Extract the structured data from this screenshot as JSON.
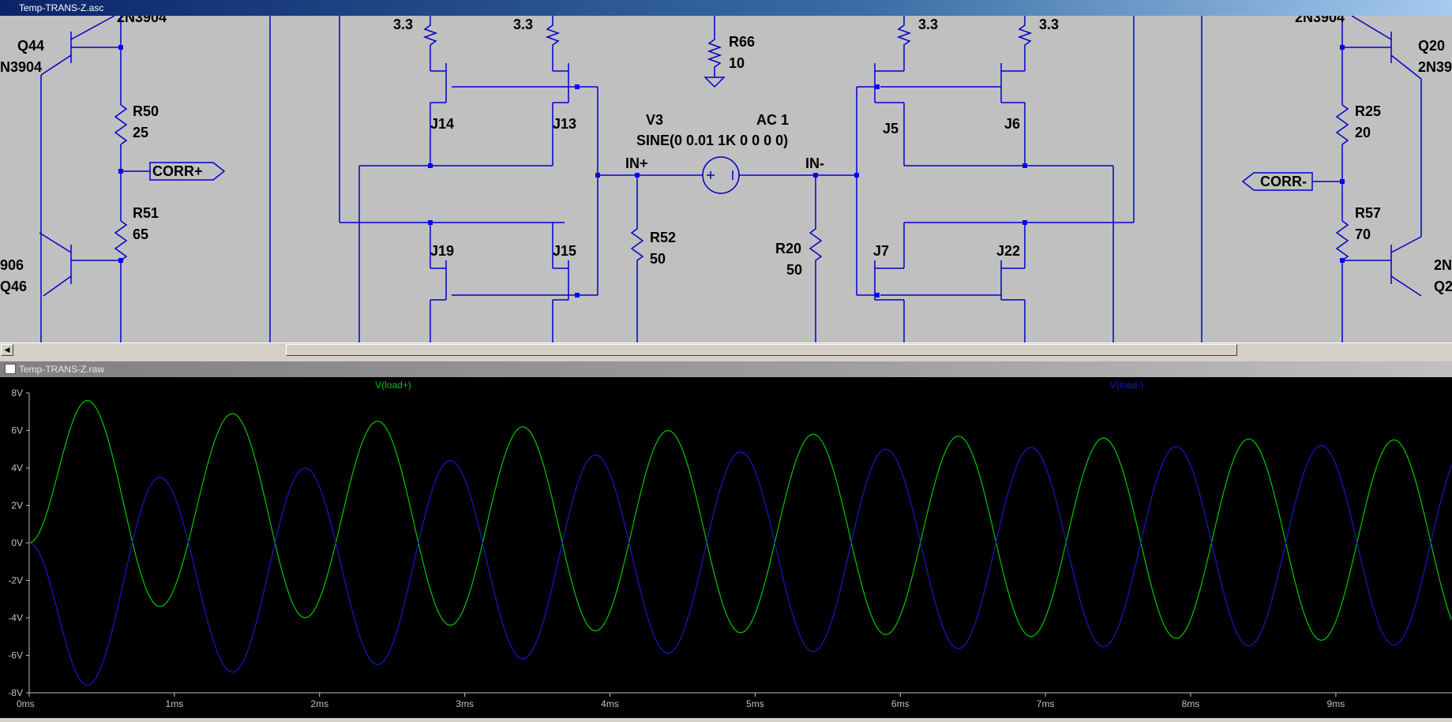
{
  "schematic_window": {
    "title": "Temp-TRANS-Z.asc"
  },
  "waveform_window": {
    "title": "Temp-TRANS-Z.raw"
  },
  "schematic": {
    "labels": {
      "q44_partial_model": "2N3904",
      "q44": "Q44",
      "q44_model": "N3904",
      "r50": "R50",
      "r50_val": "25",
      "corr_plus": "CORR+",
      "r51": "R51",
      "r51_val": "65",
      "q46_model": "906",
      "q46": "Q46",
      "j14_supply": "3.3",
      "j13_supply": "3.3",
      "j14": "J14",
      "j13": "J13",
      "j19": "J19",
      "j15": "J15",
      "r66": "R66",
      "r66_val": "10",
      "v3": "V3",
      "v3_ac": "AC 1",
      "v3_sine": "SINE(0 0.01 1K 0 0 0 0)",
      "in_plus": "IN+",
      "in_minus": "IN-",
      "r52": "R52",
      "r52_val": "50",
      "r20": "R20",
      "r20_val": "50",
      "j5_supply": "3.3",
      "j6_supply": "3.3",
      "j5": "J5",
      "j6": "J6",
      "j7": "J7",
      "j22": "J22",
      "q20_partial_model": "2N3904",
      "q20": "Q20",
      "q20_model": "2N39",
      "r25": "R25",
      "r25_val": "20",
      "corr_minus": "CORR-",
      "r57": "R57",
      "r57_val": "70",
      "q2x_model": "2N",
      "q2x": "Q2"
    }
  },
  "colors": {
    "wire": "#0000cc",
    "junction": "#0000ff",
    "trace_plus": "#00c800",
    "trace_minus": "#1818c8",
    "axis": "#c0c0c0"
  },
  "chart_data": {
    "type": "line",
    "x_label_unit": "ms",
    "xlim": [
      0,
      9.8
    ],
    "ylim": [
      -8,
      8
    ],
    "x_ticks": [
      "0ms",
      "1ms",
      "2ms",
      "3ms",
      "4ms",
      "5ms",
      "6ms",
      "7ms",
      "8ms",
      "9ms"
    ],
    "y_ticks": [
      "8V",
      "6V",
      "4V",
      "2V",
      "0V",
      "-2V",
      "-4V",
      "-6V",
      "-8V"
    ],
    "frequency_khz": 1,
    "series": [
      {
        "name": "V(load+)",
        "color": "#00c800",
        "peaks_ms": [
          0.4,
          0.9,
          1.4,
          1.9,
          2.4,
          2.9,
          3.4,
          3.9,
          4.4,
          4.9,
          5.4,
          5.9,
          6.4,
          6.9,
          7.4,
          7.9,
          8.4,
          8.9,
          9.4
        ],
        "peak_values": [
          7.6,
          -3.4,
          6.9,
          -4.0,
          6.5,
          -4.4,
          6.2,
          -4.7,
          6.0,
          -4.8,
          5.8,
          -4.9,
          5.7,
          -5.0,
          5.6,
          -5.1,
          5.55,
          -5.2,
          5.5
        ]
      },
      {
        "name": "V(load-)",
        "color": "#1818c8",
        "peaks_ms": [
          0.4,
          0.9,
          1.4,
          1.9,
          2.4,
          2.9,
          3.4,
          3.9,
          4.4,
          4.9,
          5.4,
          5.9,
          6.4,
          6.9,
          7.4,
          7.9,
          8.4,
          8.9,
          9.4
        ],
        "peak_values": [
          -7.6,
          3.5,
          -6.9,
          4.0,
          -6.5,
          4.4,
          -6.2,
          4.7,
          -5.9,
          4.85,
          -5.8,
          5.0,
          -5.65,
          5.1,
          -5.55,
          5.15,
          -5.5,
          5.2,
          -5.45
        ]
      }
    ]
  }
}
